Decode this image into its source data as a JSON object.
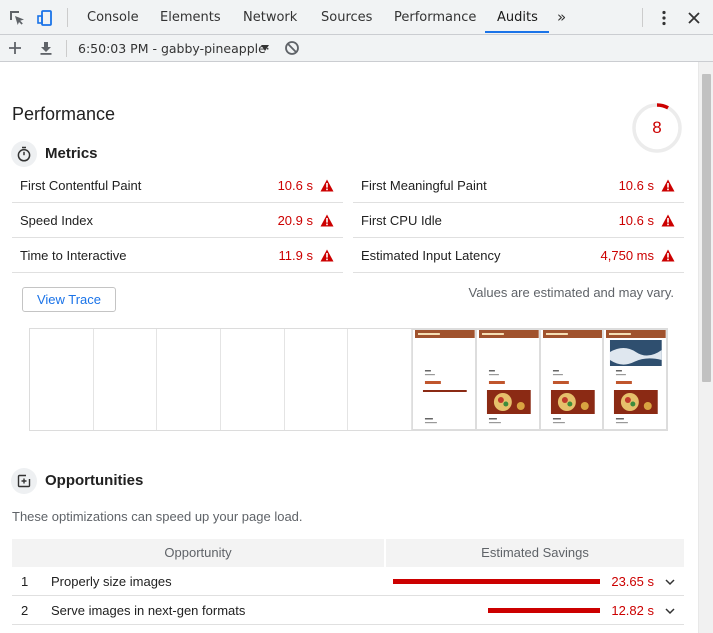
{
  "toolbar": {
    "tabs": [
      {
        "label": "Console"
      },
      {
        "label": "Elements"
      },
      {
        "label": "Network"
      },
      {
        "label": "Sources"
      },
      {
        "label": "Performance"
      },
      {
        "label": "Audits"
      }
    ],
    "active_tab": "Audits",
    "overflow_label": "»",
    "accent_color": "#1a73e8"
  },
  "subbar": {
    "session": "6:50:03 PM - gabby-pineapple·"
  },
  "performance": {
    "title": "Performance",
    "score": "8",
    "score_fraction": 0.08,
    "score_color": "#cc0000"
  },
  "metrics": {
    "title": "Metrics",
    "items": [
      {
        "label": "First Contentful Paint",
        "value": "10.6 s"
      },
      {
        "label": "First Meaningful Paint",
        "value": "10.6 s"
      },
      {
        "label": "Speed Index",
        "value": "20.9 s"
      },
      {
        "label": "First CPU Idle",
        "value": "10.6 s"
      },
      {
        "label": "Time to Interactive",
        "value": "11.9 s"
      },
      {
        "label": "Estimated Input Latency",
        "value": "4,750 ms"
      }
    ],
    "view_trace": "View Trace",
    "estimate_note": "Values are estimated and may vary."
  },
  "filmstrip": {
    "frame_count": 10,
    "loaded_from": 6
  },
  "opportunities": {
    "title": "Opportunities",
    "description": "These optimizations can speed up your page load.",
    "col_opportunity": "Opportunity",
    "col_savings": "Estimated Savings",
    "rows": [
      {
        "num": "1",
        "label": "Properly size images",
        "value": "23.65 s",
        "fraction": 1.0
      },
      {
        "num": "2",
        "label": "Serve images in next-gen formats",
        "value": "12.82 s",
        "fraction": 0.54
      }
    ]
  }
}
